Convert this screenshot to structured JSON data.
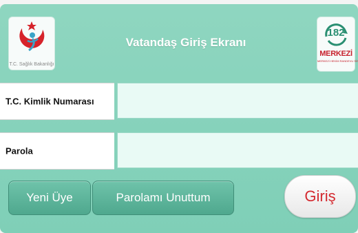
{
  "header": {
    "title": "Vatandaş Giriş Ekranı",
    "left_logo": {
      "icon": "ministry-of-health-logo-icon",
      "caption": "T.C. Sağlık Bakanlığı"
    },
    "right_logo": {
      "icon": "182-merkezi-logo-icon",
      "number": "182",
      "word": "MERKEZİ",
      "subtitle": "MERKEZİ HEKİM RANDEVU SİSTEMİ"
    }
  },
  "form": {
    "tc_label": "T.C. Kimlik Numarası",
    "tc_value": "",
    "password_label": "Parola",
    "password_value": ""
  },
  "actions": {
    "register_label": "Yeni Üye",
    "forgot_label": "Parolamı Unuttum",
    "login_label": "Giriş"
  },
  "colors": {
    "panel": "#7fcfb7",
    "button": "#4fa88e",
    "login_text": "#d42a30",
    "input_bg": "#e9faf5"
  }
}
